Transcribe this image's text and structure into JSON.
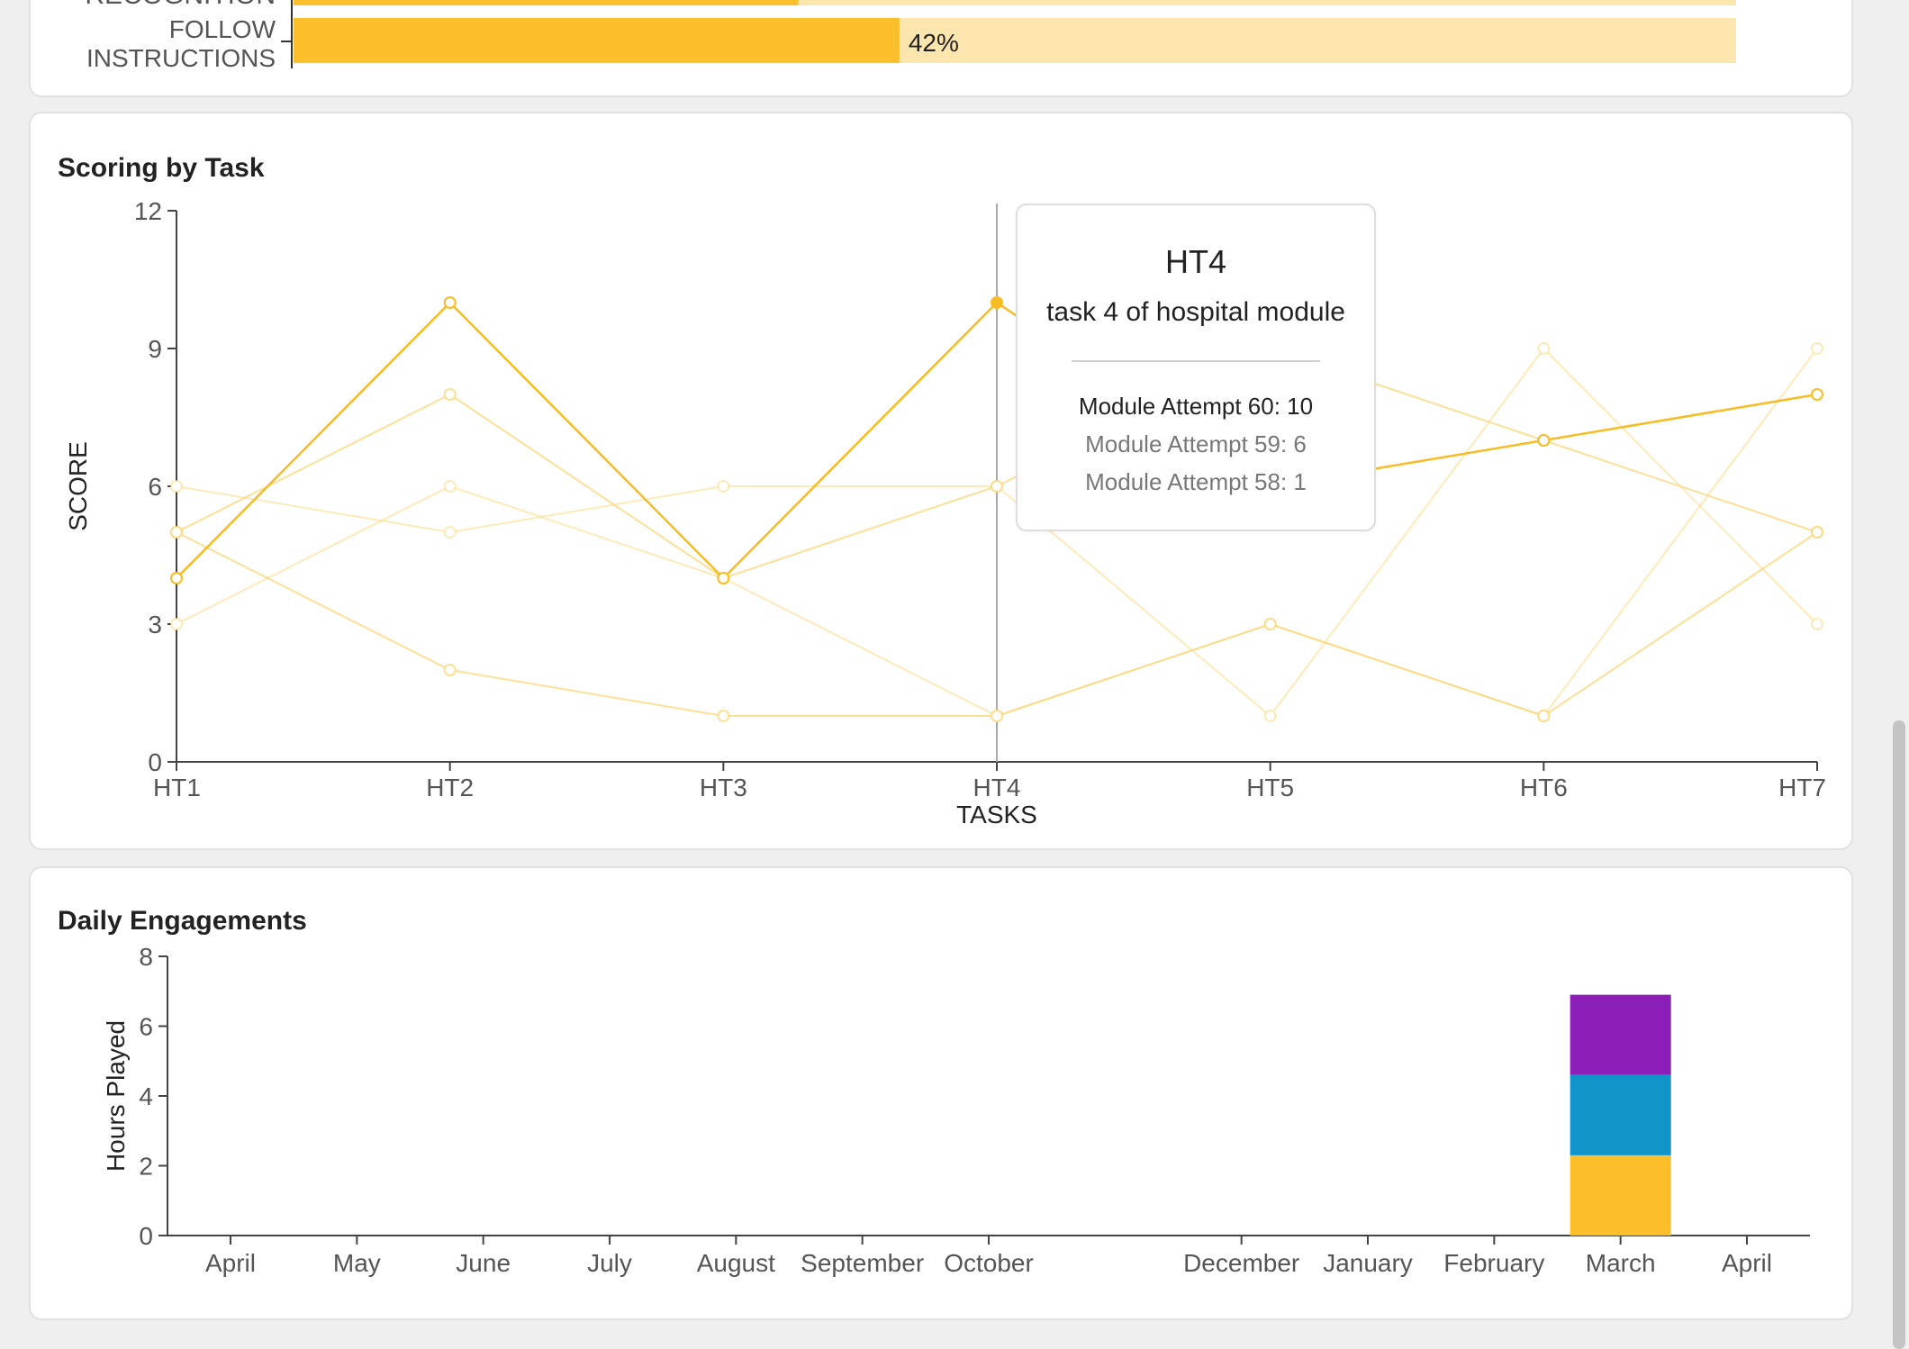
{
  "top_section": {
    "partial_label": "RECOGNITION",
    "rows": [
      {
        "label_lines": [
          "FOLLOW",
          "INSTRUCTIONS"
        ],
        "value": 42,
        "value_label": "42%"
      }
    ],
    "partial_row_value": 35,
    "colors": {
      "fill": "#fbbf2c",
      "track": "#fde6ad"
    }
  },
  "scoring_card": {
    "title": "Scoring by Task",
    "tooltip": {
      "title": "HT4",
      "subtitle": "task 4 of hospital module",
      "rows": [
        "Module Attempt 60: 10",
        "Module Attempt 59: 6",
        "Module Attempt 58: 1"
      ]
    }
  },
  "engagement_card": {
    "title": "Daily Engagements"
  },
  "chart_data": [
    {
      "type": "line",
      "title": "Scoring by Task",
      "xlabel": "TASKS",
      "ylabel": "SCORE",
      "categories": [
        "HT1",
        "HT2",
        "HT3",
        "HT4",
        "HT5",
        "HT6",
        "HT7"
      ],
      "ylim": [
        0,
        12
      ],
      "yticks": [
        0,
        3,
        6,
        9,
        12
      ],
      "grid": false,
      "hover_category": "HT4",
      "series": [
        {
          "name": "Module Attempt 60",
          "values": [
            4,
            10,
            4,
            10,
            6,
            7,
            8
          ],
          "color": "#f8bc23",
          "opacity": 1.0
        },
        {
          "name": "Module Attempt 59",
          "values": [
            5,
            8,
            4,
            6,
            9,
            7,
            5
          ],
          "color": "#fbd36b",
          "opacity": 0.7
        },
        {
          "name": "Module Attempt 58",
          "values": [
            5,
            2,
            1,
            1,
            3,
            1,
            5
          ],
          "color": "#fbd36b",
          "opacity": 0.7
        },
        {
          "values": [
            6,
            5,
            6,
            6,
            1,
            9,
            3
          ],
          "color": "#fcdc8a",
          "opacity": 0.6
        },
        {
          "values": [
            3,
            6,
            4,
            1,
            3,
            1,
            9
          ],
          "color": "#fcdc8a",
          "opacity": 0.6
        }
      ]
    },
    {
      "type": "bar",
      "stacked": true,
      "title": "Daily Engagements",
      "ylabel": "Hours Played",
      "ylim": [
        0,
        8
      ],
      "yticks": [
        0,
        2,
        4,
        6,
        8
      ],
      "grid": false,
      "categories": [
        "April",
        "May",
        "June",
        "July",
        "August",
        "September",
        "October",
        "",
        "December",
        "January",
        "February",
        "March",
        "April"
      ],
      "series": [
        {
          "values": [
            0,
            0,
            0,
            0,
            0,
            0,
            0,
            0,
            0,
            0,
            0,
            2.3,
            0
          ],
          "color": "#fbbf2c"
        },
        {
          "values": [
            0,
            0,
            0,
            0,
            0,
            0,
            0,
            0,
            0,
            0,
            0,
            2.3,
            0
          ],
          "color": "#1195c8"
        },
        {
          "values": [
            0,
            0,
            0,
            0,
            0,
            0,
            0,
            0,
            0,
            0,
            0,
            2.3,
            0
          ],
          "color": "#8b1fb8"
        }
      ]
    }
  ]
}
